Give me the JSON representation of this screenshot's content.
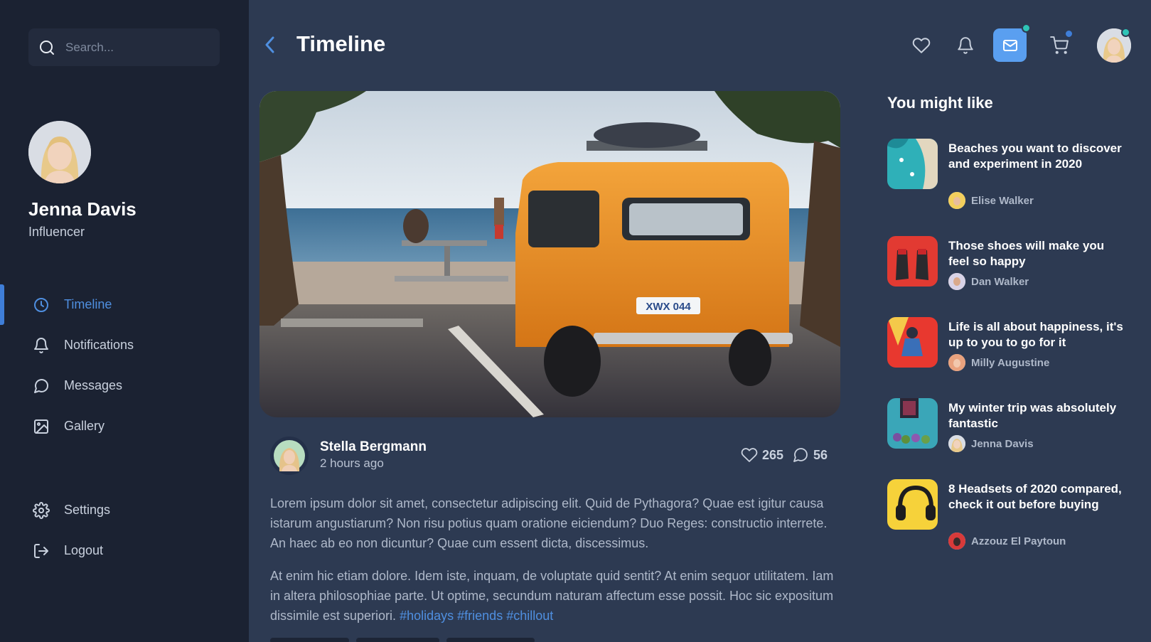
{
  "sidebar": {
    "search": {
      "placeholder": "Search..."
    },
    "profile": {
      "name": "Jenna Davis",
      "role": "Influencer"
    },
    "nav": [
      {
        "label": "Timeline",
        "icon": "clock-icon",
        "active": true
      },
      {
        "label": "Notifications",
        "icon": "bell-icon"
      },
      {
        "label": "Messages",
        "icon": "chat-icon"
      },
      {
        "label": "Gallery",
        "icon": "image-icon"
      }
    ],
    "nav_bottom": [
      {
        "label": "Settings",
        "icon": "gear-icon"
      },
      {
        "label": "Logout",
        "icon": "logout-icon"
      }
    ]
  },
  "header": {
    "title": "Timeline",
    "icons": [
      "heart-icon",
      "bell-icon",
      "mail-icon",
      "cart-icon"
    ],
    "badge_colors": {
      "mail": "#2ec4b6",
      "cart": "#3f7ed8",
      "avatar": "#2ec4b6"
    }
  },
  "post": {
    "author": "Stella Bergmann",
    "time": "2 hours ago",
    "likes": "265",
    "comments": "56",
    "paragraph1": "Lorem ipsum dolor sit amet, consectetur adipiscing elit. Quid de Pythagora? Quae est igitur causa istarum angustiarum? Non risu potius quam oratione eiciendum? Duo Reges: constructio interrete. An haec ab eo non dicuntur? Quae cum essent dicta, discessimus.",
    "paragraph2": "At enim hic etiam dolore. Idem iste, inquam, de voluptate quid sentit? At enim sequor utilitatem. Iam in altera philosophiae parte. Ut optime, secundum naturam affectum esse possit. Hoc sic expositum dissimile est superiori.",
    "hashtags": [
      "#holidays",
      "#friends",
      "#chillout"
    ],
    "plate": "XWX 044"
  },
  "suggestions": {
    "title": "You might like",
    "items": [
      {
        "title": "Beaches you want to discover and experiment in 2020",
        "author": "Elise Walker"
      },
      {
        "title": "Those shoes will make you feel so happy",
        "author": "Dan Walker"
      },
      {
        "title": "Life is all about happiness, it's up to you to go for it",
        "author": "Milly Augustine"
      },
      {
        "title": "My winter trip was absolutely fantastic",
        "author": "Jenna Davis"
      },
      {
        "title": "8 Headsets of 2020 compared, check it out before buying",
        "author": "Azzouz El Paytoun"
      }
    ]
  },
  "colors": {
    "accent": "#3f7ed8",
    "sidebar_bg": "#1b2232",
    "main_bg": "#2d3a52"
  }
}
